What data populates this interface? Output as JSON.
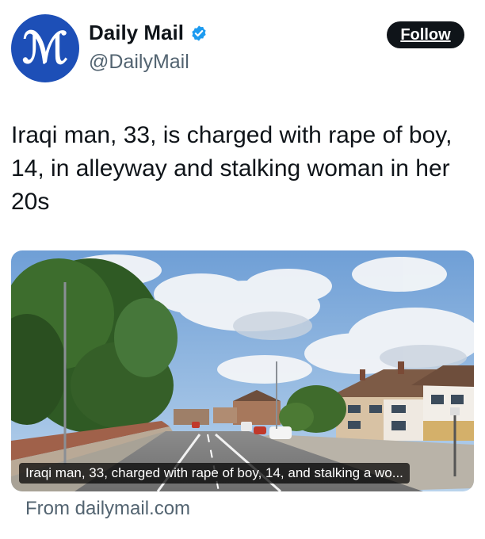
{
  "account": {
    "display_name": "Daily Mail",
    "handle": "@DailyMail",
    "avatar_letters": "M",
    "verified": true,
    "brand_color": "#1d4fb7"
  },
  "follow_button": {
    "label": "Follow"
  },
  "tweet": {
    "text": "Iraqi man, 33, is charged with rape of boy, 14, in alleyway and stalking woman in her 20s"
  },
  "link_card": {
    "caption": "Iraqi man, 33, charged with rape of boy, 14, and stalking a wo...",
    "source": "From dailymail.com",
    "image_subject": "street-scene"
  },
  "icons": {
    "verified": "verified-badge-icon"
  }
}
